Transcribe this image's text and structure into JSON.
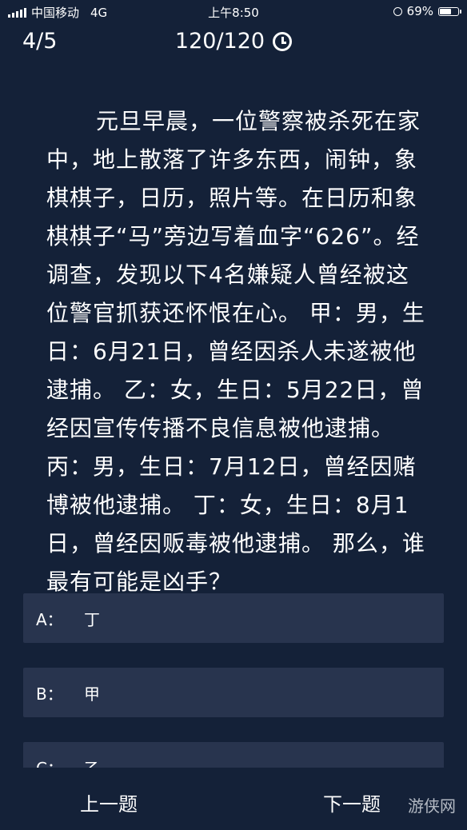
{
  "status_bar": {
    "carrier": "中国移动",
    "network": "4G",
    "time": "上午8:50",
    "battery": "69%",
    "battery_level": 0.69
  },
  "header": {
    "progress": "4/5",
    "timer": "120/120"
  },
  "question": {
    "text": "元旦早晨，一位警察被杀死在家中，地上散落了许多东西，闹钟，象棋棋子，日历，照片等。在日历和象棋棋子“马”旁边写着血字“626”。经调查，发现以下4名嫌疑人曾经被这位警官抓获还怀恨在心。 甲：男，生日：6月21日，曾经因杀人未遂被他逮捕。 乙：女，生日：5月22日，曾经因宣传传播不良信息被他逮捕。 丙：男，生日：7月12日，曾经因赌博被他逮捕。 丁：女，生日：8月1日，曾经因贩毒被他逮捕。 那么，谁最有可能是凶手？"
  },
  "options": [
    {
      "key": "A：",
      "label": "丁"
    },
    {
      "key": "B：",
      "label": "甲"
    },
    {
      "key": "C：",
      "label": "乙"
    }
  ],
  "footer": {
    "prev_label": "上一题",
    "next_label": "下一题",
    "logo": "游侠网"
  }
}
